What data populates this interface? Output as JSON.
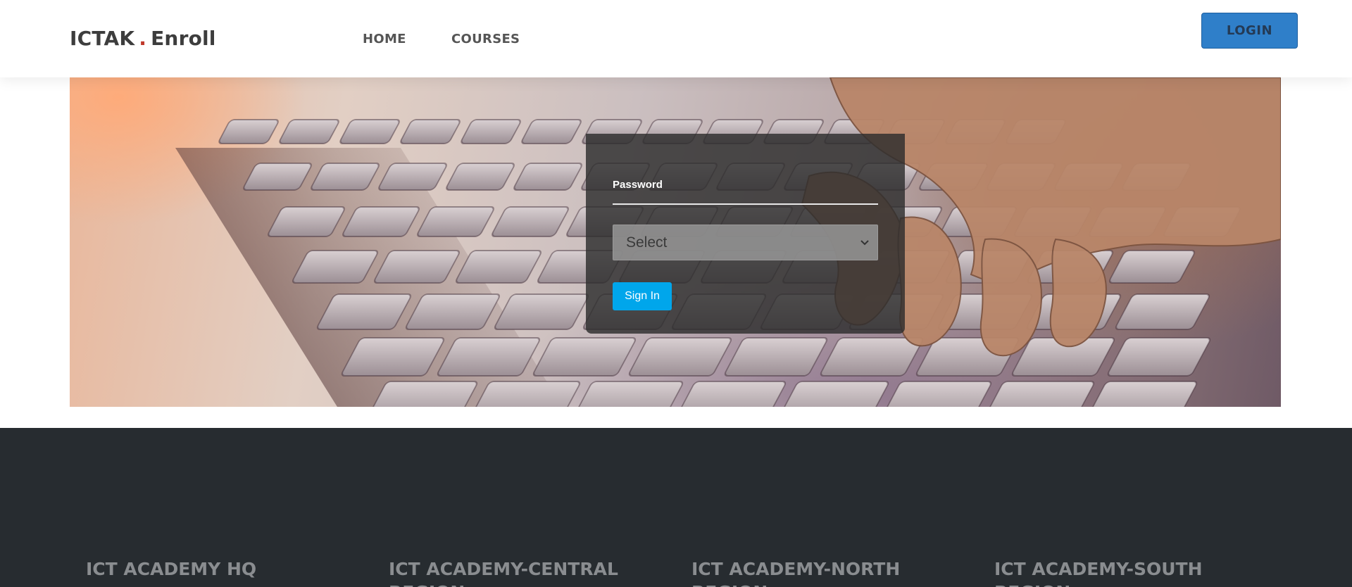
{
  "header": {
    "logo_primary": "ICTAK",
    "logo_dot": ".",
    "logo_secondary": "Enroll",
    "nav": [
      {
        "label": "HOME"
      },
      {
        "label": "COURSES"
      }
    ],
    "login_label": "LOGIN"
  },
  "login_form": {
    "password_label": "Password",
    "password_value": "",
    "role_select": {
      "selected": "Select"
    },
    "submit_label": "Sign In"
  },
  "footer": {
    "columns": [
      {
        "title": "ICT ACADEMY HQ"
      },
      {
        "title": "ICT ACADEMY-CENTRAL REGION"
      },
      {
        "title": "ICT ACADEMY-NORTH REGION"
      },
      {
        "title": "ICT ACADEMY-SOUTH REGION"
      }
    ]
  },
  "colors": {
    "brand_dot": "#c0392b",
    "login_button": "#2f7fc9",
    "sign_in_button": "#00a6eb",
    "footer_bg": "#272c30"
  },
  "icons": {
    "select_chevron": "chevron-down-icon"
  }
}
